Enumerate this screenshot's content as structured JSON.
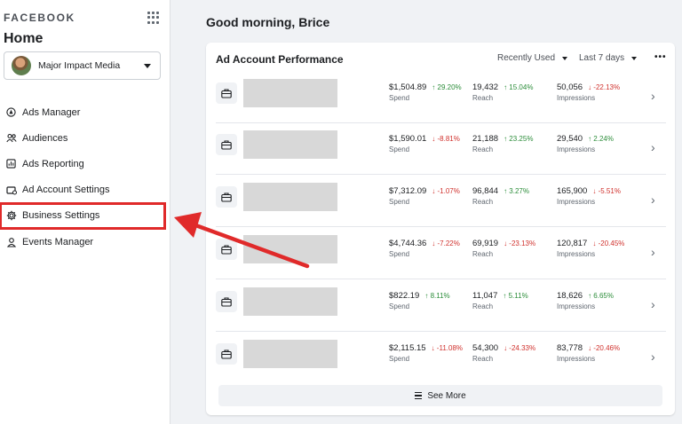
{
  "sidebar": {
    "brand": "FACEBOOK",
    "home_title": "Home",
    "account": "Major Impact Media",
    "items": [
      {
        "label": "Ads Manager",
        "icon": "ads-manager-icon"
      },
      {
        "label": "Audiences",
        "icon": "audiences-icon"
      },
      {
        "label": "Ads Reporting",
        "icon": "ads-reporting-icon"
      },
      {
        "label": "Ad Account Settings",
        "icon": "ad-account-settings-icon"
      },
      {
        "label": "Business Settings",
        "icon": "gear-icon"
      },
      {
        "label": "Events Manager",
        "icon": "events-manager-icon"
      }
    ]
  },
  "main": {
    "greeting": "Good morning, Brice",
    "card": {
      "title": "Ad Account Performance",
      "sort_filter": "Recently Used",
      "date_filter": "Last 7 days",
      "more": "•••",
      "see_more": "See More",
      "rows": [
        {
          "spend": "$1,504.89",
          "spend_chg": "29.20%",
          "spend_dir": "up",
          "reach": "19,432",
          "reach_chg": "15.04%",
          "reach_dir": "up",
          "impr": "50,056",
          "impr_chg": "-22.13%",
          "impr_dir": "down"
        },
        {
          "spend": "$1,590.01",
          "spend_chg": "-8.81%",
          "spend_dir": "down",
          "reach": "21,188",
          "reach_chg": "23.25%",
          "reach_dir": "up",
          "impr": "29,540",
          "impr_chg": "2.24%",
          "impr_dir": "up"
        },
        {
          "spend": "$7,312.09",
          "spend_chg": "-1.07%",
          "spend_dir": "down",
          "reach": "96,844",
          "reach_chg": "3.27%",
          "reach_dir": "up",
          "impr": "165,900",
          "impr_chg": "-5.51%",
          "impr_dir": "down"
        },
        {
          "spend": "$4,744.36",
          "spend_chg": "-7.22%",
          "spend_dir": "down",
          "reach": "69,919",
          "reach_chg": "-23.13%",
          "reach_dir": "down",
          "impr": "120,817",
          "impr_chg": "-20.45%",
          "impr_dir": "down"
        },
        {
          "spend": "$822.19",
          "spend_chg": "8.11%",
          "spend_dir": "up",
          "reach": "11,047",
          "reach_chg": "5.11%",
          "reach_dir": "up",
          "impr": "18,626",
          "impr_chg": "6.65%",
          "impr_dir": "up"
        },
        {
          "spend": "$2,115.15",
          "spend_chg": "-11.08%",
          "spend_dir": "down",
          "reach": "54,300",
          "reach_chg": "-24.33%",
          "reach_dir": "down",
          "impr": "83,778",
          "impr_chg": "-20.46%",
          "impr_dir": "down"
        }
      ],
      "labels": {
        "spend": "Spend",
        "reach": "Reach",
        "impressions": "Impressions"
      }
    }
  },
  "colors": {
    "up": "#2c8d3a",
    "down": "#d0312d",
    "annotation": "#e02a2a"
  }
}
